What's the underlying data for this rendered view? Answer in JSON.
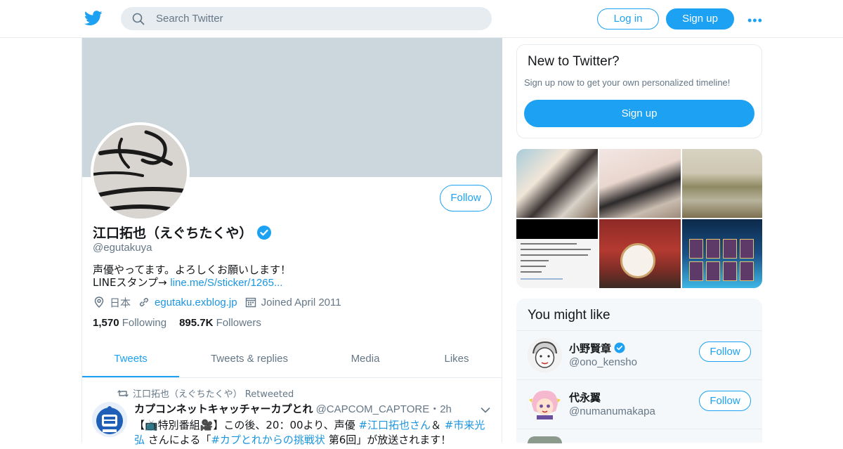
{
  "topbar": {
    "search_placeholder": "Search Twitter",
    "login_label": "Log in",
    "signup_label": "Sign up",
    "more_label": "•••"
  },
  "profile": {
    "name": "江口拓也（えぐちたくや）",
    "handle": "@egutakuya",
    "bio_line1": "声優やってます。よろしくお願いします！",
    "bio_line2_prefix": "LINEスタンプ→",
    "bio_link": "line.me/S/sticker/1265...",
    "location": "日本",
    "website": "egutaku.exblog.jp",
    "joined": "Joined April 2011",
    "following_count": "1,570",
    "following_label": "Following",
    "followers_count": "895.7K",
    "followers_label": "Followers",
    "follow_label": "Follow"
  },
  "tabs": [
    {
      "label": "Tweets",
      "active": true
    },
    {
      "label": "Tweets & replies",
      "active": false
    },
    {
      "label": "Media",
      "active": false
    },
    {
      "label": "Likes",
      "active": false
    }
  ],
  "tweet": {
    "retweeted_by": "江口拓也（えぐちたくや） Retweeted",
    "author_name": "カプコンネットキャッチャーカプとれ",
    "author_handle": "@CAPCOM_CAPTORE",
    "time": "・2h",
    "line1_a": "【📺特別番組🎥】この後、20：00より、声優 ",
    "line1_tag1": "#江口拓也さん",
    "line1_b": "＆ ",
    "line1_tag2": "#市来光",
    "line2_tag2b": "弘",
    "line2_a": " さんによる「",
    "line2_tag3": "#カプとれからの挑戦状",
    "line2_b": " 第6回」が放送されます！"
  },
  "new_to_twitter": {
    "title": "New to Twitter?",
    "subtitle": "Sign up now to get your own personalized timeline!",
    "signup_label": "Sign up"
  },
  "might_like": {
    "title": "You might like",
    "users": [
      {
        "name": "小野賢章",
        "handle": "@ono_kensho",
        "verified": true,
        "follow_label": "Follow"
      },
      {
        "name": "代永翼",
        "handle": "@numanumakapa",
        "verified": false,
        "follow_label": "Follow"
      }
    ]
  },
  "colors": {
    "accent": "#1da1f2",
    "link": "#1b95e0",
    "muted": "#657786",
    "banner": "#ccd6dd"
  }
}
